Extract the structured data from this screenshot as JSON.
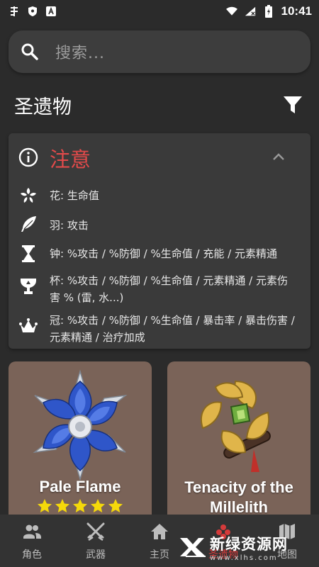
{
  "status_bar": {
    "time": "10:41",
    "left_icons": [
      "app-logo-icon",
      "shield-icon",
      "a-letter-icon"
    ],
    "right_icons": [
      "wifi-icon",
      "signal-icon",
      "battery-icon"
    ]
  },
  "search": {
    "placeholder": "搜索..."
  },
  "page": {
    "title": "圣遗物"
  },
  "notice": {
    "title": "注意",
    "title_color": "#e24a4a",
    "items": [
      {
        "icon": "flower-icon",
        "text": "花: 生命值"
      },
      {
        "icon": "feather-icon",
        "text": "羽: 攻击"
      },
      {
        "icon": "hourglass-icon",
        "text": "钟: %攻击 / %防御 / %生命值 / 充能 / 元素精通"
      },
      {
        "icon": "goblet-icon",
        "text": "杯: %攻击 / %防御 / %生命值 / 元素精通 / 元素伤害 % (雷, 水...)"
      },
      {
        "icon": "crown-icon",
        "text": "冠: %攻击 / %防御 / %生命值 / 暴击率 / 暴击伤害 / 元素精通 / 治疗加成"
      }
    ]
  },
  "cards": [
    {
      "name": "Pale Flame",
      "stars": 5
    },
    {
      "name": "Tenacity of the Millelith"
    }
  ],
  "nav": [
    {
      "label": "角色",
      "icon": "people-icon"
    },
    {
      "label": "武器",
      "icon": "crossed-swords-icon"
    },
    {
      "label": "主页",
      "icon": "home-icon"
    },
    {
      "label": "圣遗物",
      "icon": "artifact-icon"
    },
    {
      "label": "地图",
      "icon": "map-icon"
    }
  ],
  "watermark": {
    "main": "新绿资源网",
    "sub": "www.xlhs.com"
  },
  "colors": {
    "background": "#2b2b2b",
    "card": "#3a3a3a",
    "artifact_card": "#7a6358",
    "star": "#f5d90a"
  }
}
